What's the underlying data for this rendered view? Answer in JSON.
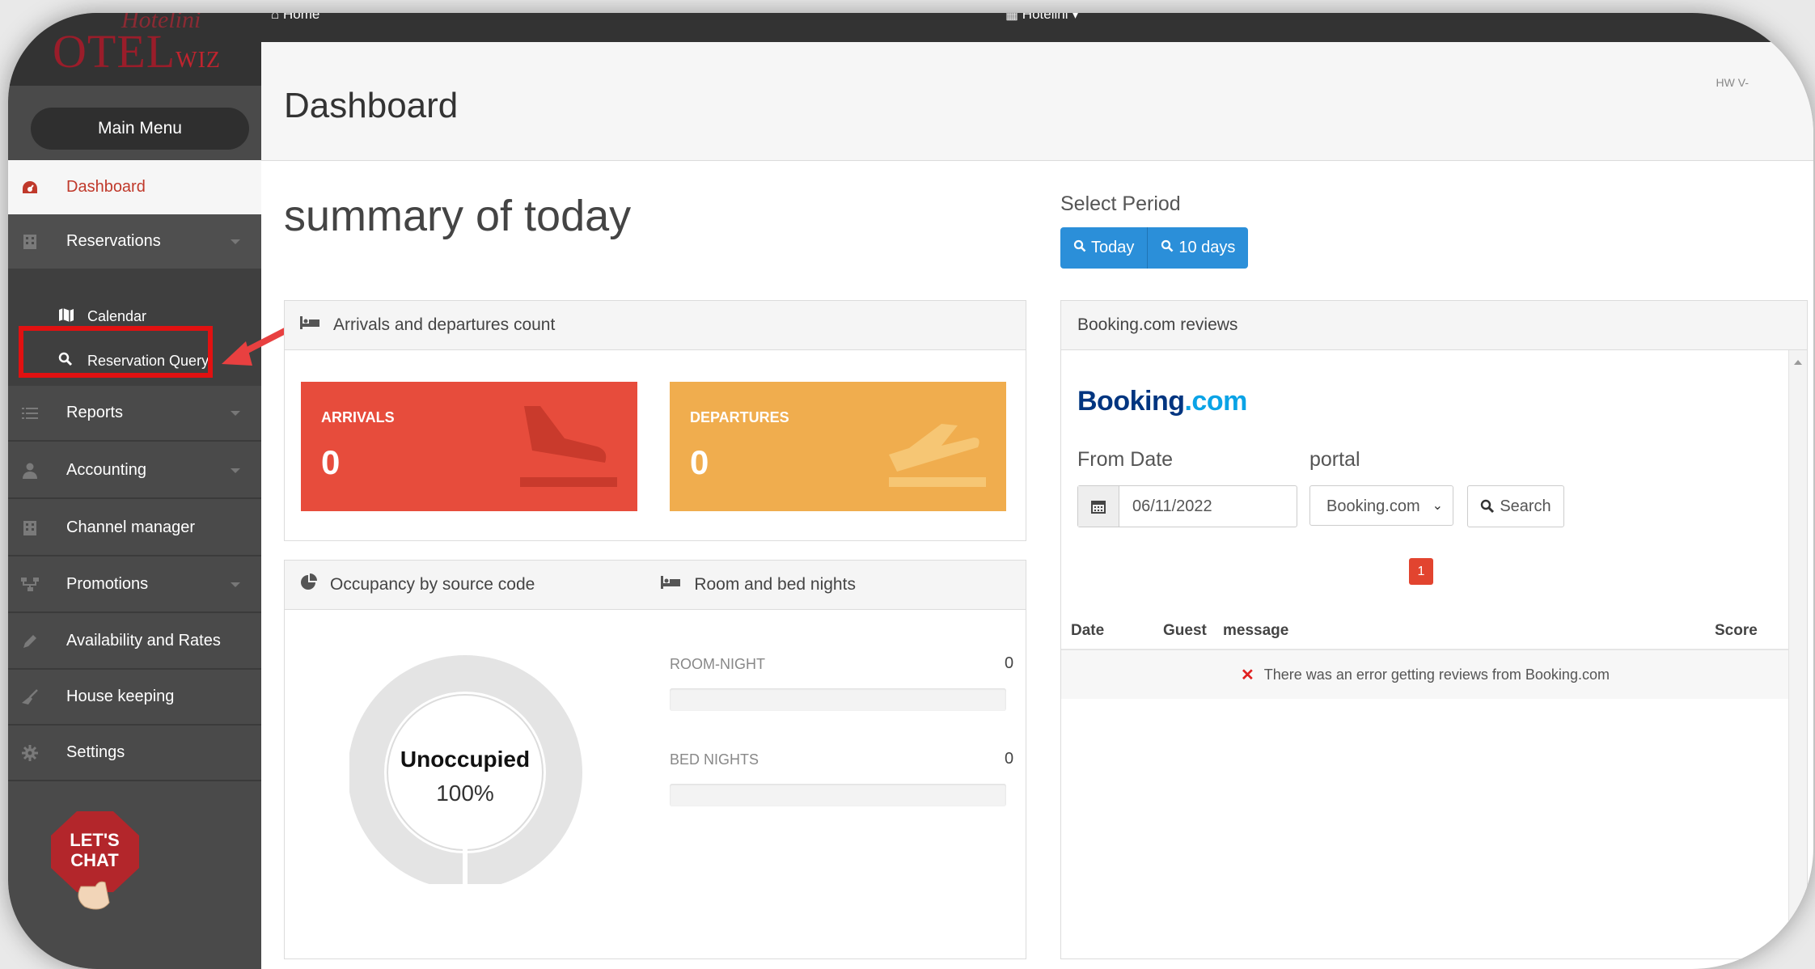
{
  "app": {
    "logo_text": "OTEL",
    "logo_suffix": "WIZ",
    "logo_top": "Hotelini"
  },
  "topbar": {
    "home_label": "Home",
    "hotel_label": "Hotelini ▾"
  },
  "header": {
    "title": "Dashboard",
    "version": "HW V-"
  },
  "sidebar": {
    "main_menu": "Main Menu",
    "items": [
      {
        "label": "Dashboard",
        "icon": "dashboard-icon"
      },
      {
        "label": "Reservations",
        "icon": "building-icon"
      },
      {
        "label": "Reports",
        "icon": "list-icon"
      },
      {
        "label": "Accounting",
        "icon": "user-icon"
      },
      {
        "label": "Channel manager",
        "icon": "building-icon"
      },
      {
        "label": "Promotions",
        "icon": "sitemap-icon"
      },
      {
        "label": "Availability and Rates",
        "icon": "pencil-icon"
      },
      {
        "label": "House keeping",
        "icon": "broom-icon"
      },
      {
        "label": "Settings",
        "icon": "gear-icon"
      }
    ],
    "sub_items": [
      {
        "label": "Calendar",
        "icon": "map-icon"
      },
      {
        "label": "Reservation Query",
        "icon": "search-icon"
      }
    ],
    "chat_text": [
      "LET'S",
      "CHAT"
    ]
  },
  "main": {
    "summary_title": "summary of today",
    "period": {
      "label": "Select Period",
      "buttons": [
        "Today",
        "10 days"
      ]
    },
    "arrivals_panel": {
      "title": "Arrivals and departures count",
      "arrivals_label": "ARRIVALS",
      "arrivals_value": "0",
      "departures_label": "DEPARTURES",
      "departures_value": "0"
    },
    "occupancy_panel": {
      "title": "Occupancy by source code",
      "title2": "Room and bed nights",
      "donut_label": "Unoccupied",
      "donut_value": "100%",
      "room_night_label": "ROOM-NIGHT",
      "room_night_value": "0",
      "bed_nights_label": "BED NIGHTS",
      "bed_nights_value": "0"
    },
    "reviews_panel": {
      "title": "Booking.com reviews",
      "brand": "Booking",
      "brand_suffix": ".com",
      "from_date_label": "From Date",
      "portal_label": "portal",
      "date_value": "06/11/2022",
      "portal_value": "Booking.com",
      "search_label": "Search",
      "page": "1",
      "columns": [
        "Date",
        "Guest",
        "message",
        "Score"
      ],
      "error": "There was an error getting reviews from Booking.com"
    }
  },
  "colors": {
    "arrivals": "#e74c3c",
    "departures": "#f0ad4e",
    "accent": "#2b8fd9",
    "active": "#c0392b"
  }
}
